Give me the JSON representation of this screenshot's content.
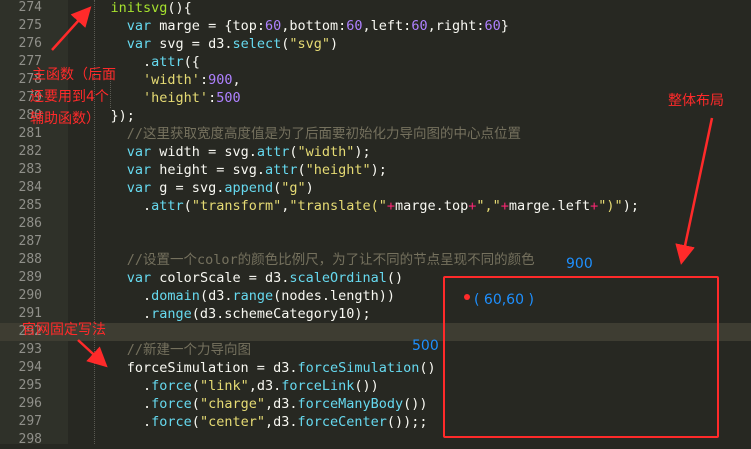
{
  "lines": [
    {
      "n": "274",
      "segs": [
        [
          "",
          "    "
        ],
        [
          "#a6e22e",
          "initsvg"
        ],
        [
          "",
          "(){"
        ]
      ]
    },
    {
      "n": "275",
      "segs": [
        [
          "",
          "      "
        ],
        [
          "#66d9ef",
          "var"
        ],
        [
          "",
          " marge = {top:"
        ],
        [
          "#ae81ff",
          "60"
        ],
        [
          "",
          ",bottom:"
        ],
        [
          "#ae81ff",
          "60"
        ],
        [
          "",
          ",left:"
        ],
        [
          "#ae81ff",
          "60"
        ],
        [
          "",
          ",right:"
        ],
        [
          "#ae81ff",
          "60"
        ],
        [
          "",
          "}"
        ]
      ]
    },
    {
      "n": "276",
      "segs": [
        [
          "",
          "      "
        ],
        [
          "#66d9ef",
          "var"
        ],
        [
          "",
          " svg = d3."
        ],
        [
          "#66d9ef",
          "select"
        ],
        [
          "",
          "("
        ],
        [
          "#e6db74",
          "\"svg\""
        ],
        [
          "",
          ")"
        ]
      ]
    },
    {
      "n": "277",
      "segs": [
        [
          "",
          "        ."
        ],
        [
          "#66d9ef",
          "attr"
        ],
        [
          "",
          "({"
        ]
      ]
    },
    {
      "n": "278",
      "segs": [
        [
          "",
          "        "
        ],
        [
          "#e6db74",
          "'width'"
        ],
        [
          "",
          ":"
        ],
        [
          "#ae81ff",
          "900"
        ],
        [
          "",
          ","
        ]
      ]
    },
    {
      "n": "279",
      "segs": [
        [
          "",
          "        "
        ],
        [
          "#e6db74",
          "'height'"
        ],
        [
          "",
          ":"
        ],
        [
          "#ae81ff",
          "500"
        ]
      ]
    },
    {
      "n": "280",
      "segs": [
        [
          "",
          "    });"
        ]
      ]
    },
    {
      "n": "281",
      "segs": [
        [
          "",
          "      "
        ],
        [
          "#75715e",
          "//这里获取宽度高度值是为了后面要初始化力导向图的中心点位置"
        ]
      ]
    },
    {
      "n": "282",
      "segs": [
        [
          "",
          "      "
        ],
        [
          "#66d9ef",
          "var"
        ],
        [
          "",
          " width = svg."
        ],
        [
          "#66d9ef",
          "attr"
        ],
        [
          "",
          "("
        ],
        [
          "#e6db74",
          "\"width\""
        ],
        [
          "",
          ");"
        ]
      ]
    },
    {
      "n": "283",
      "segs": [
        [
          "",
          "      "
        ],
        [
          "#66d9ef",
          "var"
        ],
        [
          "",
          " height = svg."
        ],
        [
          "#66d9ef",
          "attr"
        ],
        [
          "",
          "("
        ],
        [
          "#e6db74",
          "\"height\""
        ],
        [
          "",
          ");"
        ]
      ]
    },
    {
      "n": "284",
      "segs": [
        [
          "",
          "      "
        ],
        [
          "#66d9ef",
          "var"
        ],
        [
          "",
          " g = svg."
        ],
        [
          "#66d9ef",
          "append"
        ],
        [
          "",
          "("
        ],
        [
          "#e6db74",
          "\"g\""
        ],
        [
          "",
          ")"
        ]
      ]
    },
    {
      "n": "285",
      "segs": [
        [
          "",
          "        ."
        ],
        [
          "#66d9ef",
          "attr"
        ],
        [
          "",
          "("
        ],
        [
          "#e6db74",
          "\"transform\""
        ],
        [
          "",
          ","
        ],
        [
          "#e6db74",
          "\"translate(\""
        ],
        [
          "#f92672",
          "+"
        ],
        [
          "",
          "marge.top"
        ],
        [
          "#f92672",
          "+"
        ],
        [
          "#e6db74",
          "\",\""
        ],
        [
          "#f92672",
          "+"
        ],
        [
          "",
          "marge.left"
        ],
        [
          "#f92672",
          "+"
        ],
        [
          "#e6db74",
          "\")\""
        ],
        [
          "",
          ");"
        ]
      ]
    },
    {
      "n": "286",
      "segs": []
    },
    {
      "n": "287",
      "segs": []
    },
    {
      "n": "288",
      "segs": [
        [
          "",
          "      "
        ],
        [
          "#75715e",
          "//设置一个color的颜色比例尺，为了让不同的节点呈现不同的颜色"
        ]
      ]
    },
    {
      "n": "289",
      "segs": [
        [
          "",
          "      "
        ],
        [
          "#66d9ef",
          "var"
        ],
        [
          "",
          " colorScale = d3."
        ],
        [
          "#66d9ef",
          "scaleOrdinal"
        ],
        [
          "",
          "()"
        ]
      ]
    },
    {
      "n": "290",
      "segs": [
        [
          "",
          "        ."
        ],
        [
          "#66d9ef",
          "domain"
        ],
        [
          "",
          "(d3."
        ],
        [
          "#66d9ef",
          "range"
        ],
        [
          "",
          "(nodes.length))"
        ]
      ]
    },
    {
      "n": "291",
      "segs": [
        [
          "",
          "        ."
        ],
        [
          "#66d9ef",
          "range"
        ],
        [
          "",
          "(d3.schemeCategory10);"
        ]
      ]
    },
    {
      "n": "292",
      "segs": []
    },
    {
      "n": "293",
      "segs": [
        [
          "",
          "      "
        ],
        [
          "#75715e",
          "//新建一个力导向图"
        ]
      ]
    },
    {
      "n": "294",
      "segs": [
        [
          "",
          "      forceSimulation = d3."
        ],
        [
          "#66d9ef",
          "forceSimulation"
        ],
        [
          "",
          "()"
        ]
      ]
    },
    {
      "n": "295",
      "segs": [
        [
          "",
          "        ."
        ],
        [
          "#66d9ef",
          "force"
        ],
        [
          "",
          "("
        ],
        [
          "#e6db74",
          "\"link\""
        ],
        [
          "",
          ",d3."
        ],
        [
          "#66d9ef",
          "forceLink"
        ],
        [
          "",
          "())"
        ]
      ]
    },
    {
      "n": "296",
      "segs": [
        [
          "",
          "        ."
        ],
        [
          "#66d9ef",
          "force"
        ],
        [
          "",
          "("
        ],
        [
          "#e6db74",
          "\"charge\""
        ],
        [
          "",
          ",d3."
        ],
        [
          "#66d9ef",
          "forceManyBody"
        ],
        [
          "",
          "())"
        ]
      ]
    },
    {
      "n": "297",
      "segs": [
        [
          "",
          "        ."
        ],
        [
          "#66d9ef",
          "force"
        ],
        [
          "",
          "("
        ],
        [
          "#e6db74",
          "\"center\""
        ],
        [
          "",
          ",d3."
        ],
        [
          "#66d9ef",
          "forceCenter"
        ],
        [
          "",
          "());;"
        ]
      ]
    },
    {
      "n": "298",
      "segs": []
    }
  ],
  "annotations": {
    "main_func_1": "主函数（后面",
    "main_func_2": "还要用到4个",
    "main_func_3": "辅助函数）",
    "overall_layout": "整体布局",
    "official_style": "官网固定写法",
    "width_900": "900",
    "height_500": "500",
    "origin_point": "( 60,60 )"
  },
  "colors": {
    "background": "#272822",
    "annotation_red": "#ff2a2a",
    "annotation_blue": "#1e90ff"
  }
}
